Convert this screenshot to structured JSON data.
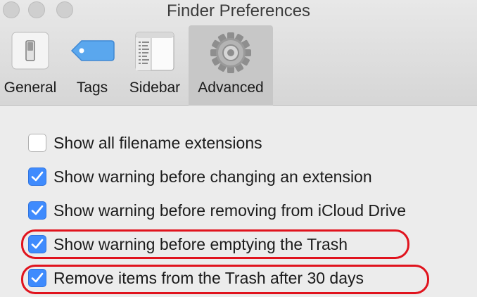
{
  "window": {
    "title": "Finder Preferences"
  },
  "toolbar": {
    "tabs": [
      {
        "label": "General",
        "icon": "general-switch-icon",
        "selected": false
      },
      {
        "label": "Tags",
        "icon": "tag-icon",
        "selected": false
      },
      {
        "label": "Sidebar",
        "icon": "sidebar-icon",
        "selected": false
      },
      {
        "label": "Advanced",
        "icon": "gear-icon",
        "selected": true
      }
    ]
  },
  "options": [
    {
      "label": "Show all filename extensions",
      "checked": false,
      "highlighted": false
    },
    {
      "label": "Show warning before changing an extension",
      "checked": true,
      "highlighted": false
    },
    {
      "label": "Show warning before removing from iCloud Drive",
      "checked": true,
      "highlighted": false
    },
    {
      "label": "Show warning before emptying the Trash",
      "checked": true,
      "highlighted": true
    },
    {
      "label": "Remove items from the Trash after 30 days",
      "checked": true,
      "highlighted": true
    }
  ],
  "colors": {
    "checkbox_checked": "#3f8bfd",
    "highlight": "#e0131d",
    "tag_icon": "#5aa7ee"
  }
}
